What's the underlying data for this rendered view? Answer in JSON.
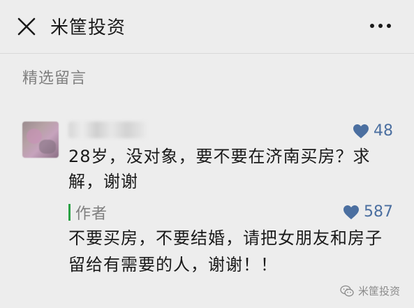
{
  "header": {
    "title": "米筐投资",
    "close_icon": "close-icon",
    "more_icon": "more-icon"
  },
  "section": {
    "label": "精选留言"
  },
  "comment": {
    "likes": "48",
    "text": "28岁，没对象，要不要在济南买房？求解，谢谢"
  },
  "reply": {
    "label": "作者",
    "likes": "587",
    "text": "不要买房，不要结婚，请把女朋友和房子留给有需要的人，谢谢！！"
  },
  "watermark": {
    "text": "米筐投资"
  },
  "colors": {
    "like_blue": "#4b6fa0",
    "author_green": "#2ba245",
    "background": "#ededed"
  }
}
